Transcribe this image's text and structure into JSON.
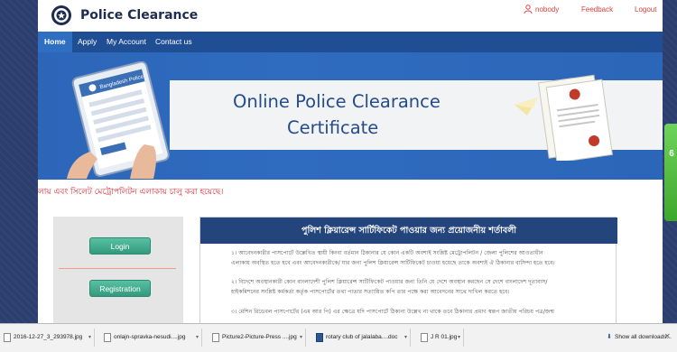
{
  "header": {
    "brand": "Police Clearance",
    "user": "nobody",
    "feedback": "Feedback",
    "logout": "Logout"
  },
  "nav": {
    "items": [
      "Home",
      "Apply",
      "My Account",
      "Contact us"
    ]
  },
  "banner": {
    "title_line1": "Online Police Clearance",
    "title_line2": "Certificate",
    "tablet_text": "Bangladesh Police"
  },
  "marquee": "লায় এবং সিলেট মেট্রোপলিটন এলাকায় চালু করা হয়েছে।",
  "leftpanel": {
    "login": "Login",
    "registration": "Registration"
  },
  "rightpanel": {
    "title": "পুলিশ ক্লিয়ারেন্স সার্টিফিকেট পাওয়ার জন্য প্রয়োজনীয় শর্তাবলী",
    "p1_line1": "১। আবেদনকারীর পাসপোর্টে উল্লেখিত স্থায়ী কিংবা বর্তমান ঠিকানার যে কোন একটি অবশ্যই সংশ্লিষ্ট মেট্রোপলিটন / জেলা পুলিশের আওতাধীন",
    "p1_line2": "এলাকায় অবস্থিত হতে হবে এবং আবেদনকারীকে/ যার জন্য পুলিশ ক্লিয়ারেন্স সার্টিফিকেট চাওয়া হয়েছে তাকে অবশ্যই ঐ ঠিকানার বাসিন্দা হতে হবে।",
    "p2_line1": "২। বিদেশে অবস্থানকারী কোন বাংলাদেশী পুলিশ ক্লিয়ারেন্স সার্টিফিকেট পাওয়ার জন্য তিনি যে দেশে অবস্থান করছেন সে দেশে বাংলাদেশ দূতাবাস/",
    "p2_line2": "হাইকমিশনের সংশ্লিষ্ট কর্মকর্তা কর্তৃক পাসপোর্টের তথ্য পাতার সত্যায়িত কপি তার পক্ষে করা আবেদনের সাথে দাখিল করতে হবে।",
    "p3_line1": "৩। মেশিন রিডেবল পাসপোর্টের (এম আর পি) এর ক্ষেত্রে যদি পাসপোর্টে ঠিকানা উল্লেখ না থাকে তবে ঠিকানার প্রমাণ স্বরূপ জাতীয় পরিচয় পত্র/জন্ম"
  },
  "sidetab": "6",
  "downloads": {
    "items": [
      "2016-12-27_3_293978.jpg",
      "onlajn-spravka-nesudi....jpg",
      "Picture2-Picture-Press ....jpg",
      "rotary club of jalalaba....doc",
      "J R 01.jpg"
    ],
    "show_all": "Show all downloads..."
  },
  "colors": {
    "nav": "#1f4e94",
    "banner": "#2d66b9",
    "panel_header": "#24457c",
    "button": "#339a7d",
    "marquee": "#e0202a"
  }
}
